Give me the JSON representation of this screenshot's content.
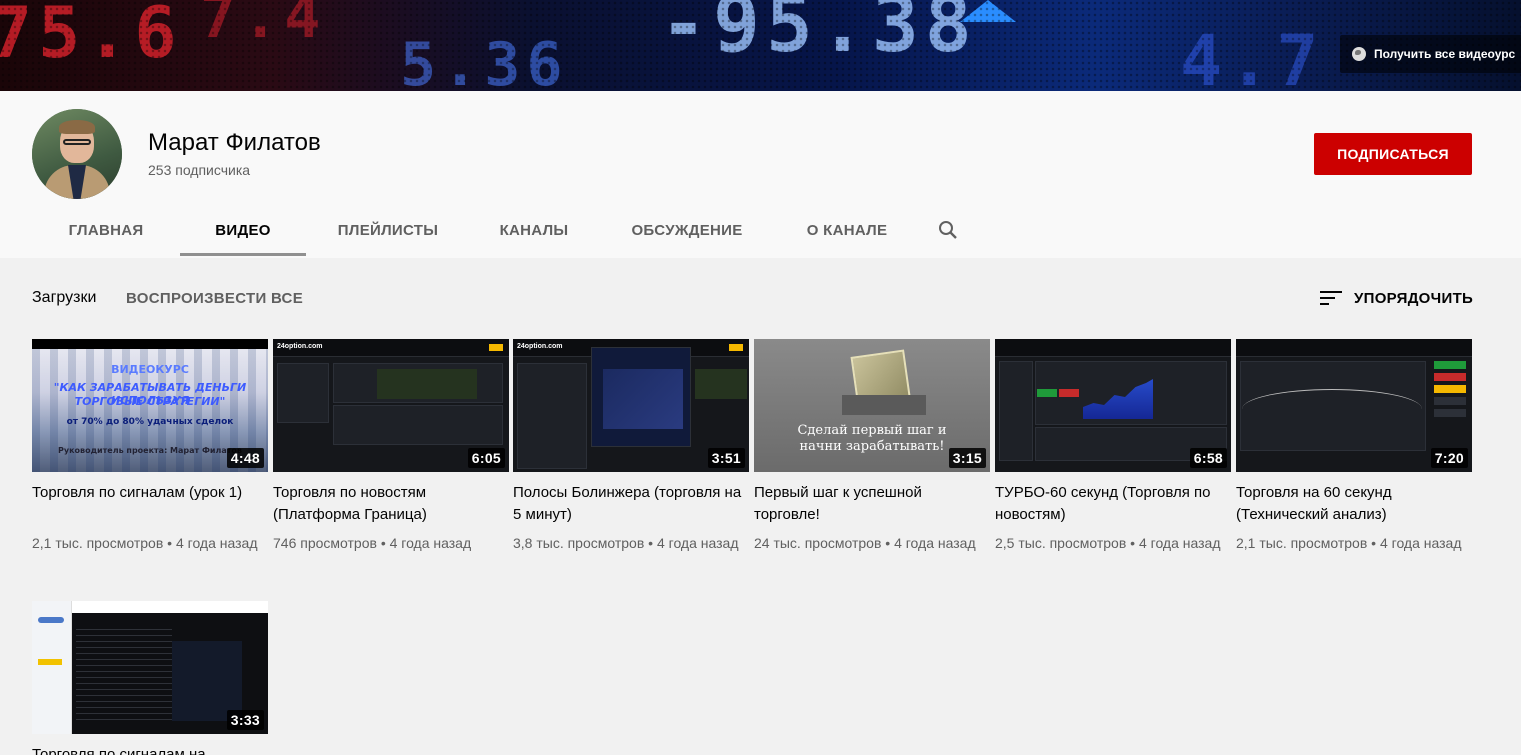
{
  "banner": {
    "link_label": "Получить все видеоурс"
  },
  "channel": {
    "name": "Марат Филатов",
    "subscribers": "253 подписчика",
    "subscribe_label": "ПОДПИСАТЬСЯ"
  },
  "tabs": [
    {
      "label": "ГЛАВНАЯ"
    },
    {
      "label": "ВИДЕО"
    },
    {
      "label": "ПЛЕЙЛИСТЫ"
    },
    {
      "label": "КАНАЛЫ"
    },
    {
      "label": "ОБСУЖДЕНИЕ"
    },
    {
      "label": "О КАНАЛЕ"
    }
  ],
  "section": {
    "title": "Загрузки",
    "play_all": "ВОСПРОИЗВЕСТИ ВСЕ",
    "sort": "УПОРЯДОЧИТЬ"
  },
  "thumb_text": {
    "t1": [
      "ВИДЕОКУРС",
      "\"КАК ЗАРАБАТЫВАТЬ ДЕНЬГИ ИСПОЛЬЗУЯ",
      "ТОРГОВЫЕ СТРАТЕГИИ\"",
      "от 70% до 80% удачных сделок",
      "Руководитель проекта: Марат Филатов"
    ],
    "t4": [
      "Сделай первый шаг и",
      "начни зарабатывать!"
    ]
  },
  "videos": [
    {
      "title": "Торговля по сигналам (урок 1)",
      "duration": "4:48",
      "meta": "2,1 тыс. просмотров • 4 года назад"
    },
    {
      "title": "Торговля по новостям (Платформа Граница)",
      "duration": "6:05",
      "meta": "746 просмотров • 4 года назад"
    },
    {
      "title": "Полосы Болинжера (торговля на 5 минут)",
      "duration": "3:51",
      "meta": "3,8 тыс. просмотров • 4 года назад"
    },
    {
      "title": "Первый шаг к успешной торговле!",
      "duration": "3:15",
      "meta": "24 тыс. просмотров • 4 года назад"
    },
    {
      "title": "ТУРБО-60 секунд (Торговля по новостям)",
      "duration": "6:58",
      "meta": "2,5 тыс. просмотров • 4 года назад"
    },
    {
      "title": "Торговля на 60 секунд (Технический анализ)",
      "duration": "7:20",
      "meta": "2,1 тыс. просмотров • 4 года назад"
    },
    {
      "title": "Торговля по сигналам на",
      "duration": "3:33",
      "meta": ""
    }
  ]
}
